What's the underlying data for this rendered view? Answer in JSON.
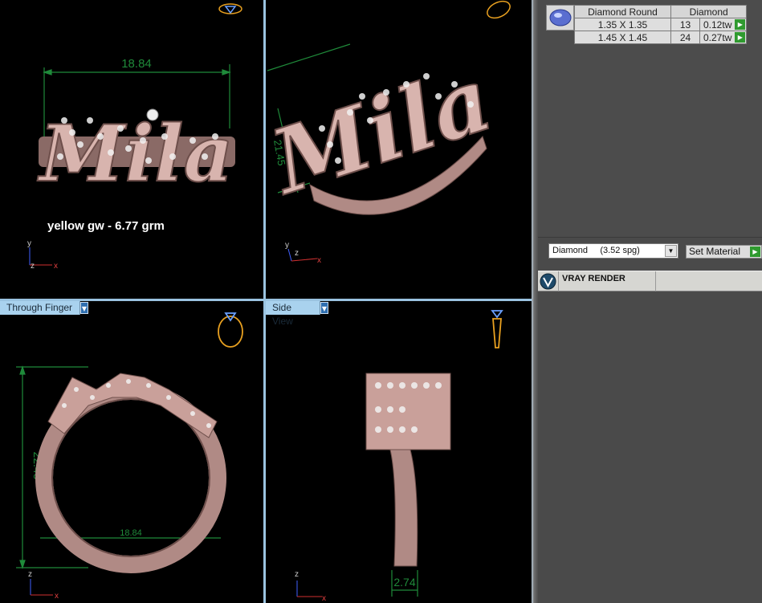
{
  "viewports": {
    "top_left": {
      "dimension_width": "18.84",
      "weight_label": "yellow gw - 6.77 grm",
      "axes": {
        "y": "y",
        "z": "z",
        "x": "x"
      }
    },
    "top_right": {
      "dimension_height": "21.45",
      "axes": {
        "y": "y",
        "z": "z",
        "x": "x"
      }
    },
    "bottom_left": {
      "tab_label": "Through Finger",
      "dimension_height": "22.45",
      "dimension_inner": "18.84",
      "axes": {
        "z": "z",
        "x": "x"
      }
    },
    "bottom_right": {
      "tab_label": "Side View",
      "dimension_width": "2.74",
      "axes": {
        "z": "z",
        "x": "x"
      }
    }
  },
  "engraving_text": "Mila",
  "gem_table": {
    "headers": [
      "Diamond Round",
      "Diamond"
    ],
    "rows": [
      {
        "size": "1.35 X 1.35",
        "count": "13",
        "weight": "0.12tw"
      },
      {
        "size": "1.45 X 1.45",
        "count": "24",
        "weight": "0.27tw"
      }
    ]
  },
  "material": {
    "name": "Diamond",
    "spg": "(3.52 spg)",
    "set_label": "Set Material"
  },
  "vray": {
    "label": "VRAY RENDER"
  },
  "colors": {
    "splitter": "#9ac3e0",
    "tab_bg": "#a9d2ee",
    "dimension": "#1f8a3a",
    "metal": "#c9a09a",
    "go_button": "#2f9a2f"
  }
}
